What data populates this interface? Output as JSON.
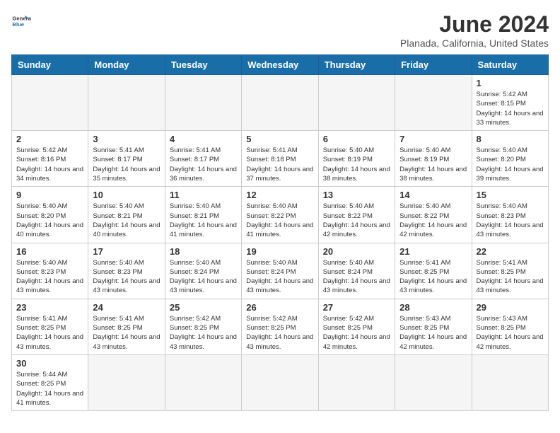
{
  "header": {
    "logo_general": "General",
    "logo_blue": "Blue",
    "month_title": "June 2024",
    "location": "Planada, California, United States"
  },
  "days_of_week": [
    "Sunday",
    "Monday",
    "Tuesday",
    "Wednesday",
    "Thursday",
    "Friday",
    "Saturday"
  ],
  "weeks": [
    [
      {
        "day": "",
        "info": ""
      },
      {
        "day": "",
        "info": ""
      },
      {
        "day": "",
        "info": ""
      },
      {
        "day": "",
        "info": ""
      },
      {
        "day": "",
        "info": ""
      },
      {
        "day": "",
        "info": ""
      },
      {
        "day": "1",
        "info": "Sunrise: 5:42 AM\nSunset: 8:15 PM\nDaylight: 14 hours and 33 minutes."
      }
    ],
    [
      {
        "day": "2",
        "info": "Sunrise: 5:42 AM\nSunset: 8:16 PM\nDaylight: 14 hours and 34 minutes."
      },
      {
        "day": "3",
        "info": "Sunrise: 5:41 AM\nSunset: 8:17 PM\nDaylight: 14 hours and 35 minutes."
      },
      {
        "day": "4",
        "info": "Sunrise: 5:41 AM\nSunset: 8:17 PM\nDaylight: 14 hours and 36 minutes."
      },
      {
        "day": "5",
        "info": "Sunrise: 5:41 AM\nSunset: 8:18 PM\nDaylight: 14 hours and 37 minutes."
      },
      {
        "day": "6",
        "info": "Sunrise: 5:40 AM\nSunset: 8:19 PM\nDaylight: 14 hours and 38 minutes."
      },
      {
        "day": "7",
        "info": "Sunrise: 5:40 AM\nSunset: 8:19 PM\nDaylight: 14 hours and 38 minutes."
      },
      {
        "day": "8",
        "info": "Sunrise: 5:40 AM\nSunset: 8:20 PM\nDaylight: 14 hours and 39 minutes."
      }
    ],
    [
      {
        "day": "9",
        "info": "Sunrise: 5:40 AM\nSunset: 8:20 PM\nDaylight: 14 hours and 40 minutes."
      },
      {
        "day": "10",
        "info": "Sunrise: 5:40 AM\nSunset: 8:21 PM\nDaylight: 14 hours and 40 minutes."
      },
      {
        "day": "11",
        "info": "Sunrise: 5:40 AM\nSunset: 8:21 PM\nDaylight: 14 hours and 41 minutes."
      },
      {
        "day": "12",
        "info": "Sunrise: 5:40 AM\nSunset: 8:22 PM\nDaylight: 14 hours and 41 minutes."
      },
      {
        "day": "13",
        "info": "Sunrise: 5:40 AM\nSunset: 8:22 PM\nDaylight: 14 hours and 42 minutes."
      },
      {
        "day": "14",
        "info": "Sunrise: 5:40 AM\nSunset: 8:22 PM\nDaylight: 14 hours and 42 minutes."
      },
      {
        "day": "15",
        "info": "Sunrise: 5:40 AM\nSunset: 8:23 PM\nDaylight: 14 hours and 43 minutes."
      }
    ],
    [
      {
        "day": "16",
        "info": "Sunrise: 5:40 AM\nSunset: 8:23 PM\nDaylight: 14 hours and 43 minutes."
      },
      {
        "day": "17",
        "info": "Sunrise: 5:40 AM\nSunset: 8:23 PM\nDaylight: 14 hours and 43 minutes."
      },
      {
        "day": "18",
        "info": "Sunrise: 5:40 AM\nSunset: 8:24 PM\nDaylight: 14 hours and 43 minutes."
      },
      {
        "day": "19",
        "info": "Sunrise: 5:40 AM\nSunset: 8:24 PM\nDaylight: 14 hours and 43 minutes."
      },
      {
        "day": "20",
        "info": "Sunrise: 5:40 AM\nSunset: 8:24 PM\nDaylight: 14 hours and 43 minutes."
      },
      {
        "day": "21",
        "info": "Sunrise: 5:41 AM\nSunset: 8:25 PM\nDaylight: 14 hours and 43 minutes."
      },
      {
        "day": "22",
        "info": "Sunrise: 5:41 AM\nSunset: 8:25 PM\nDaylight: 14 hours and 43 minutes."
      }
    ],
    [
      {
        "day": "23",
        "info": "Sunrise: 5:41 AM\nSunset: 8:25 PM\nDaylight: 14 hours and 43 minutes."
      },
      {
        "day": "24",
        "info": "Sunrise: 5:41 AM\nSunset: 8:25 PM\nDaylight: 14 hours and 43 minutes."
      },
      {
        "day": "25",
        "info": "Sunrise: 5:42 AM\nSunset: 8:25 PM\nDaylight: 14 hours and 43 minutes."
      },
      {
        "day": "26",
        "info": "Sunrise: 5:42 AM\nSunset: 8:25 PM\nDaylight: 14 hours and 43 minutes."
      },
      {
        "day": "27",
        "info": "Sunrise: 5:42 AM\nSunset: 8:25 PM\nDaylight: 14 hours and 42 minutes."
      },
      {
        "day": "28",
        "info": "Sunrise: 5:43 AM\nSunset: 8:25 PM\nDaylight: 14 hours and 42 minutes."
      },
      {
        "day": "29",
        "info": "Sunrise: 5:43 AM\nSunset: 8:25 PM\nDaylight: 14 hours and 42 minutes."
      }
    ],
    [
      {
        "day": "30",
        "info": "Sunrise: 5:44 AM\nSunset: 8:25 PM\nDaylight: 14 hours and 41 minutes."
      },
      {
        "day": "",
        "info": ""
      },
      {
        "day": "",
        "info": ""
      },
      {
        "day": "",
        "info": ""
      },
      {
        "day": "",
        "info": ""
      },
      {
        "day": "",
        "info": ""
      },
      {
        "day": "",
        "info": ""
      }
    ]
  ]
}
